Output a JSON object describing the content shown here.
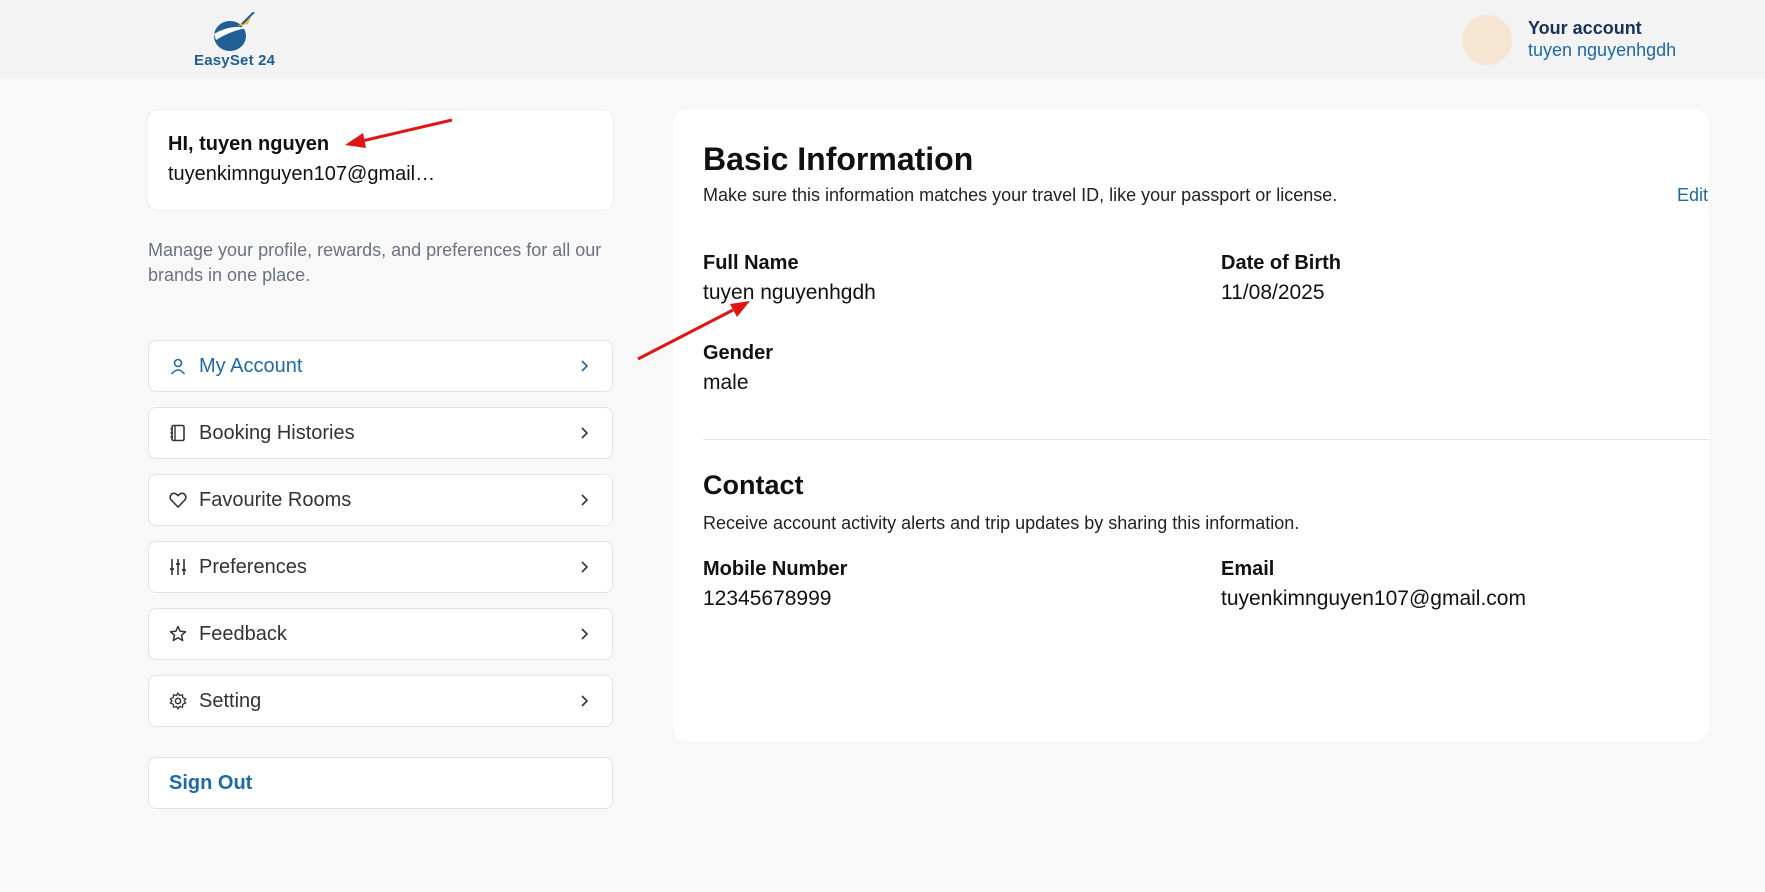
{
  "header": {
    "logo_text": "EasySet 24",
    "account_title": "Your account",
    "account_name": "tuyen nguyenhgdh"
  },
  "sidebar": {
    "greeting": "HI, tuyen nguyen",
    "email_truncated": "tuyenkimnguyen107@gmail.com",
    "description": "Manage your profile, rewards, and preferences for all our brands in one place.",
    "items": [
      {
        "label": "My Account",
        "icon": "user-icon",
        "active": true
      },
      {
        "label": "Booking Histories",
        "icon": "book-icon"
      },
      {
        "label": "Favourite Rooms",
        "icon": "heart-icon"
      },
      {
        "label": "Preferences",
        "icon": "sliders-icon"
      },
      {
        "label": "Feedback",
        "icon": "star-icon"
      },
      {
        "label": "Setting",
        "icon": "gear-icon"
      }
    ],
    "sign_out": "Sign Out"
  },
  "basic": {
    "title": "Basic Information",
    "subtitle": "Make sure this information matches your travel ID, like your passport or license.",
    "edit": "Edit",
    "full_name_label": "Full Name",
    "full_name": "tuyen nguyenhgdh",
    "dob_label": "Date of Birth",
    "dob": "11/08/2025",
    "gender_label": "Gender",
    "gender": "male"
  },
  "contact": {
    "title": "Contact",
    "subtitle": "Receive account activity alerts and trip updates by sharing this information.",
    "mobile_label": "Mobile Number",
    "mobile": "12345678999",
    "email_label": "Email",
    "email": "tuyenkimnguyen107@gmail.com"
  },
  "colors": {
    "accent": "#1d6aa6",
    "annotation_arrow": "#e01515"
  }
}
